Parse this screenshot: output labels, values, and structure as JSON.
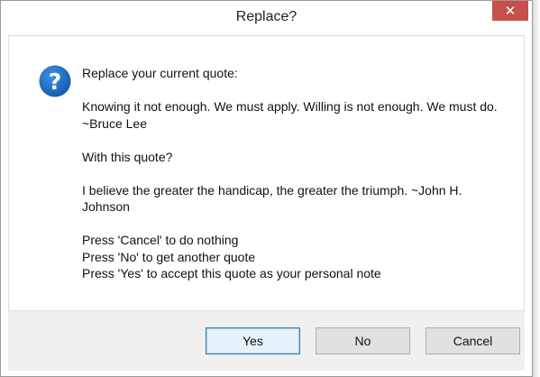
{
  "window": {
    "title": "Replace?",
    "close_glyph": "✕"
  },
  "message": {
    "icon": "question-icon",
    "icon_color": "#1c6fc9",
    "lines": [
      "Replace your current quote:",
      "Knowing it not enough. We must apply. Willing is not enough. We must do. ~Bruce Lee",
      "With this quote?",
      "I believe the greater the handicap, the greater the triumph. ~John H. Johnson",
      "Press 'Cancel' to do nothing",
      "Press 'No' to get another quote",
      "Press 'Yes' to accept this quote as your personal note"
    ]
  },
  "buttons": {
    "yes": "Yes",
    "no": "No",
    "cancel": "Cancel"
  },
  "colors": {
    "close_bg": "#c7504b",
    "footer_bg": "#f0f0f0"
  }
}
